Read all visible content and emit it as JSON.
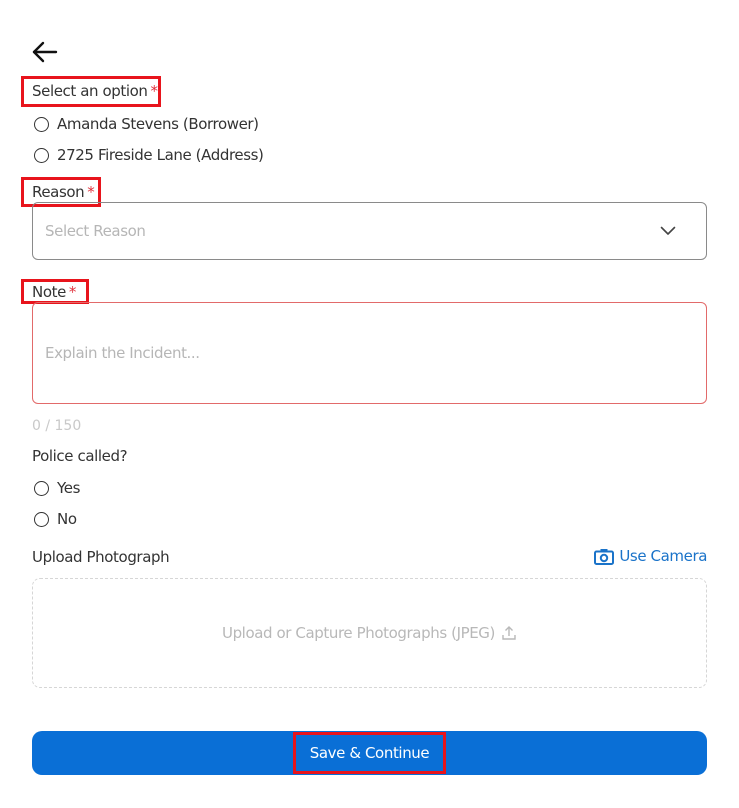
{
  "header": {
    "back_icon": "arrow-left-icon"
  },
  "option": {
    "label": "Select an option",
    "required_mark": "*",
    "choices": [
      {
        "label": "Amanda Stevens (Borrower)"
      },
      {
        "label": "2725 Fireside Lane (Address)"
      }
    ]
  },
  "reason": {
    "label": "Reason",
    "required_mark": "*",
    "placeholder": "Select Reason",
    "dropdown_icon": "chevron-down-icon"
  },
  "note": {
    "label": "Note",
    "required_mark": "*",
    "placeholder": "Explain the Incident...",
    "counter": "0 / 150"
  },
  "police": {
    "label": "Police called?",
    "choices": [
      {
        "label": "Yes"
      },
      {
        "label": "No"
      }
    ]
  },
  "upload": {
    "label": "Upload Photograph",
    "camera_label": "Use Camera",
    "camera_icon": "camera-icon",
    "dropzone_text": "Upload or Capture Photographs (JPEG)",
    "upload_icon": "upload-icon"
  },
  "actions": {
    "save_label": "Save & Continue"
  },
  "colors": {
    "primary": "#0a6fd6",
    "link": "#1a73c9",
    "required": "#e0313c",
    "highlight": "#e8141c",
    "error_border": "#e26a6a"
  }
}
